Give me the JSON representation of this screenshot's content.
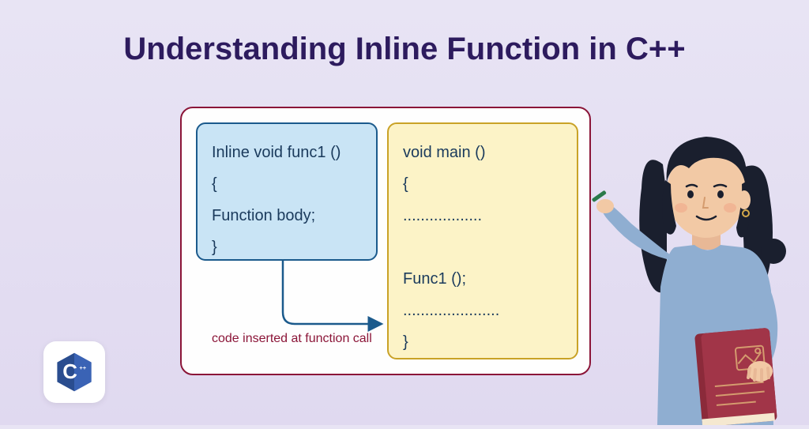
{
  "title": "Understanding Inline Function in C++",
  "diagram": {
    "left_box": {
      "line1": "Inline void func1 ()",
      "line2": "{",
      "line3": "Function body;",
      "line4": "}"
    },
    "right_box": {
      "line1": "void main ()",
      "line2": "{",
      "line3": "..................",
      "line4": "",
      "line5": "Func1 ();",
      "line6": "......................",
      "line7": "}"
    },
    "arrow_label": "code inserted at function call"
  },
  "logo": {
    "letter": "C",
    "plus": "++"
  },
  "colors": {
    "title": "#2d1b5e",
    "container_border": "#8b1538",
    "left_box_bg": "#c9e4f5",
    "left_box_border": "#1b5a8c",
    "right_box_bg": "#fcf3c7",
    "right_box_border": "#c9a227",
    "arrow": "#1b5a8c",
    "label": "#8b1538"
  }
}
